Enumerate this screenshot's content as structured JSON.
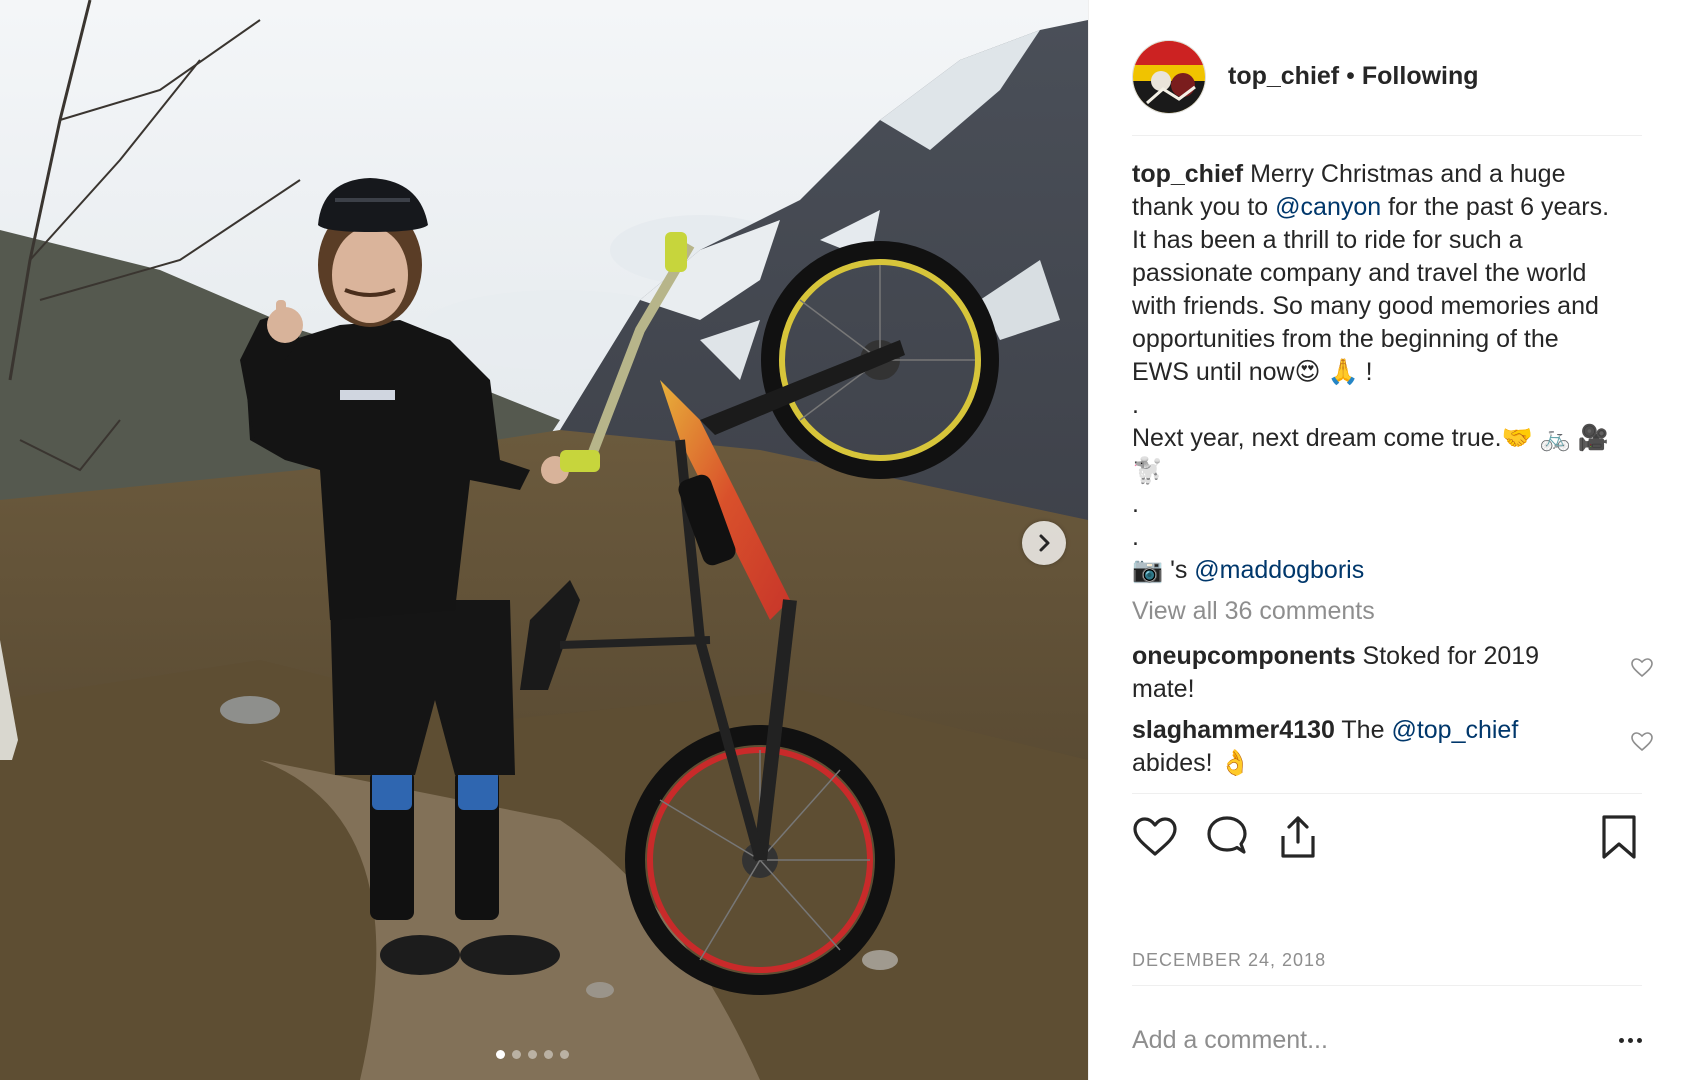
{
  "post": {
    "username": "top_chief",
    "separator": "•",
    "follow_status": "Following",
    "photo_alt": "Rider holding a mountain bike upright in a snowy mountain valley",
    "carousel": {
      "total": 5,
      "active": 0
    }
  },
  "caption": {
    "username": "top_chief",
    "line1_a": "Merry Christmas and a huge",
    "line2_a": "thank you to ",
    "mention1": "@canyon",
    "line2_b": " for the past 6 years.",
    "line3": "It has been a thrill to ride for such a",
    "line4": "passionate company and travel the world",
    "line5": "with friends. So many good memories and",
    "line6": "opportunities from the beginning of the",
    "line7": "EWS until now😍 🙏 !",
    "dot1": ".",
    "line8": "Next year, next dream come true.🤝 🚲 🎥",
    "line9": "🐩",
    "dot2": ".",
    "dot3": ".",
    "photo_credit_a": "📷 's ",
    "mention2": "@maddogboris"
  },
  "view_all": "View all 36 comments",
  "comments": [
    {
      "user": "oneupcomponents",
      "text": " Stoked for 2019",
      "text2": "mate!"
    },
    {
      "user": "slaghammer4130",
      "text": " The ",
      "mention": "@top_chief",
      "text2": "abides! 👌"
    }
  ],
  "date": "DECEMBER 24, 2018",
  "add_comment_placeholder": "Add a comment...",
  "colors": {
    "text": "#262626",
    "muted": "#8e8e8e",
    "mention": "#00376b",
    "divider": "#efefef"
  },
  "icons": {
    "next": "chevron-right-icon",
    "like": "heart-icon",
    "comment": "comment-bubble-icon",
    "share": "share-icon",
    "save": "bookmark-icon",
    "more": "ellipsis-icon"
  }
}
